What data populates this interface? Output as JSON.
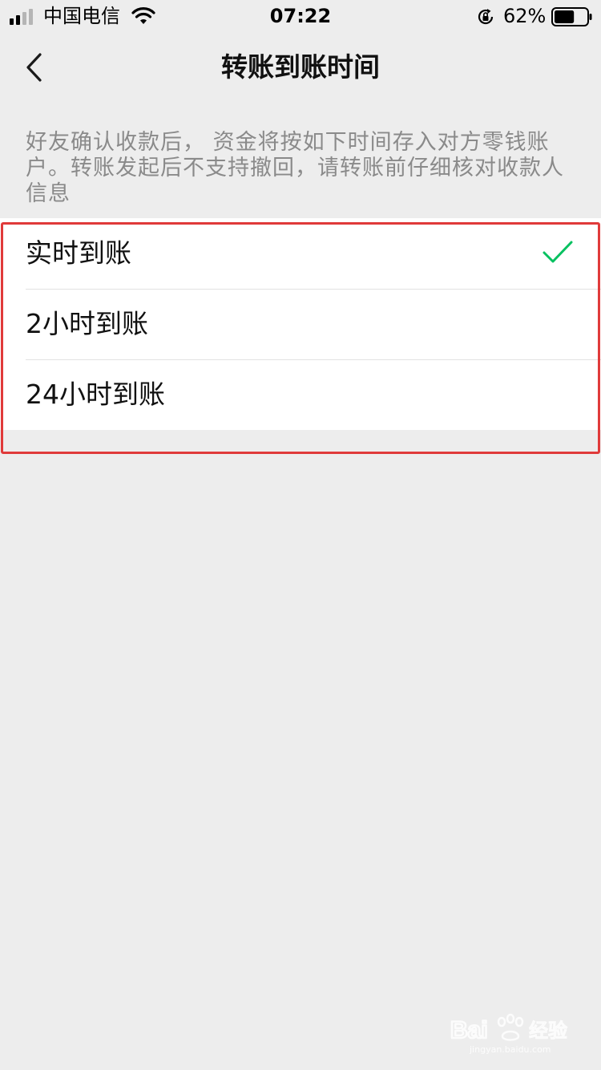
{
  "status_bar": {
    "carrier": "中国电信",
    "time": "07:22",
    "battery_percent": "62%",
    "battery_level": 0.62,
    "icons": [
      "signal-icon",
      "wifi-icon",
      "rotation-lock-icon",
      "battery-icon"
    ]
  },
  "nav": {
    "title": "转账到账时间",
    "back_icon": "chevron-left-icon"
  },
  "description": "好友确认收款后， 资金将按如下时间存入对方零钱账户。转账发起后不支持撤回，请转账前仔细核对收款人信息",
  "options": [
    {
      "label": "实时到账",
      "selected": true
    },
    {
      "label": "2小时到账",
      "selected": false
    },
    {
      "label": "24小时到账",
      "selected": false
    }
  ],
  "colors": {
    "background": "#ededed",
    "card": "#ffffff",
    "check": "#07c160",
    "highlight": "#e03a3a",
    "description_text": "#8a8a8a"
  },
  "watermark": {
    "logo_text": "Baidu经验",
    "url": "jingyan.baidu.com"
  }
}
